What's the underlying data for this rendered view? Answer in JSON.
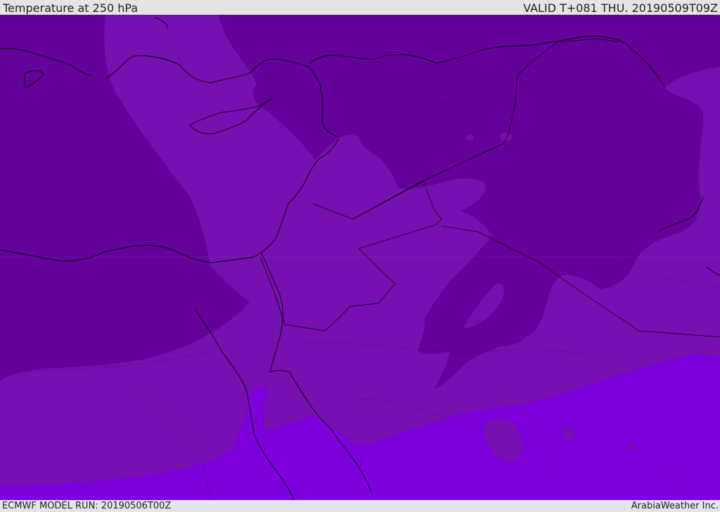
{
  "header": {
    "title": "Temperature at 250 hPa",
    "valid_time": "VALID T+081 THU. 20190509T09Z"
  },
  "footer": {
    "model_run": "ECMWF MODEL RUN: 20190506T00Z",
    "credit": "ArabiaWeather Inc."
  },
  "colors": {
    "coldest": "#65009a",
    "middle": "#7710b0",
    "warmest": "#7c00dc",
    "coastline": "#000000",
    "bar_background": "#e4e4e4"
  }
}
